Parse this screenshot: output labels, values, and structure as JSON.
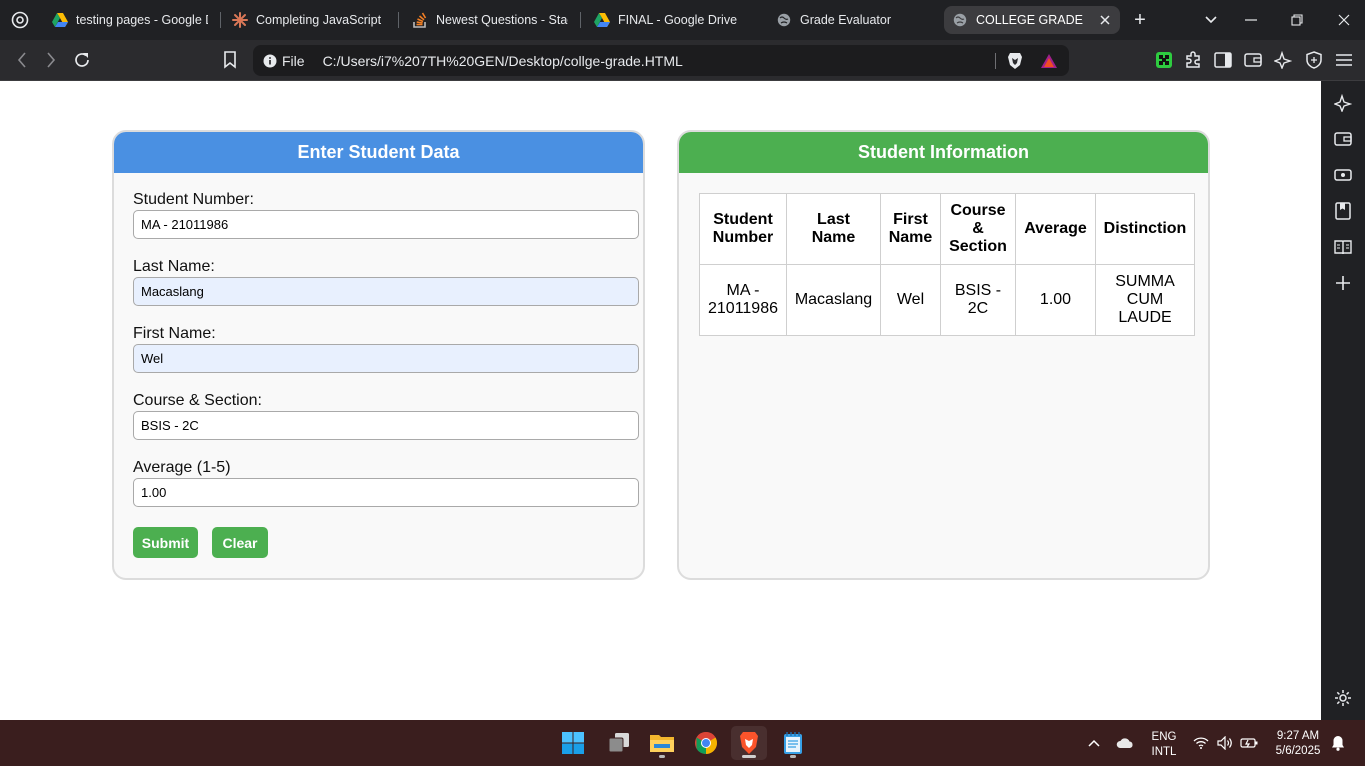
{
  "browser": {
    "tabs": [
      {
        "title": "testing pages - Google D",
        "icon": "google-drive-icon",
        "active": false
      },
      {
        "title": "Completing JavaScript C",
        "icon": "claude-asterisk-icon",
        "active": false
      },
      {
        "title": "Newest Questions - Stack",
        "icon": "stackoverflow-icon",
        "active": false
      },
      {
        "title": "FINAL - Google Drive",
        "icon": "google-drive-icon",
        "active": false
      },
      {
        "title": "Grade Evaluator",
        "icon": "globe-icon",
        "active": false
      },
      {
        "title": "COLLEGE GRADE",
        "icon": "globe-icon",
        "active": true
      }
    ],
    "new_tab_symbol": "+",
    "omnibox": {
      "scheme_label": "File",
      "url": "C:/Users/i7%207TH%20GEN/Desktop/collge-grade.HTML"
    }
  },
  "form_card": {
    "title": "Enter Student Data",
    "fields": [
      {
        "label": "Student Number:",
        "value": "MA - 21011986",
        "autofilled": false
      },
      {
        "label": "Last Name:",
        "value": "Macaslang",
        "autofilled": true
      },
      {
        "label": "First Name:",
        "value": "Wel",
        "autofilled": true
      },
      {
        "label": "Course & Section:",
        "value": "BSIS - 2C",
        "autofilled": false
      },
      {
        "label": "Average (1-5)",
        "value": "1.00",
        "autofilled": false
      }
    ],
    "submit_label": "Submit",
    "clear_label": "Clear"
  },
  "info_card": {
    "title": "Student Information",
    "table": {
      "headers": [
        [
          "Student",
          "Number"
        ],
        [
          "Last",
          "Name"
        ],
        [
          "First",
          "Name"
        ],
        [
          "Course",
          "&",
          "Section"
        ],
        [
          "Average"
        ],
        [
          "Distinction"
        ]
      ],
      "rows": [
        [
          [
            "MA -",
            "21011986"
          ],
          [
            "Macaslang"
          ],
          [
            "Wel"
          ],
          [
            "BSIS -",
            "2C"
          ],
          [
            "1.00"
          ],
          [
            "SUMMA",
            "CUM",
            "LAUDE"
          ]
        ]
      ]
    }
  },
  "taskbar": {
    "apps": [
      {
        "name": "start-button",
        "icon": "windows-logo-icon"
      },
      {
        "name": "task-view-button",
        "icon": "task-view-icon"
      },
      {
        "name": "file-explorer-button",
        "icon": "folder-icon"
      },
      {
        "name": "chrome-button",
        "icon": "chrome-icon"
      },
      {
        "name": "brave-button",
        "icon": "brave-lion-icon"
      },
      {
        "name": "notepad-button",
        "icon": "notepad-icon"
      }
    ],
    "language_top": "ENG",
    "language_bottom": "INTL",
    "time": "9:27 AM",
    "date": "5/6/2025"
  },
  "colors": {
    "form_header": "#4a90e2",
    "info_header": "#4caf50",
    "button": "#4caf50",
    "autofill": "#e8f0fe"
  }
}
